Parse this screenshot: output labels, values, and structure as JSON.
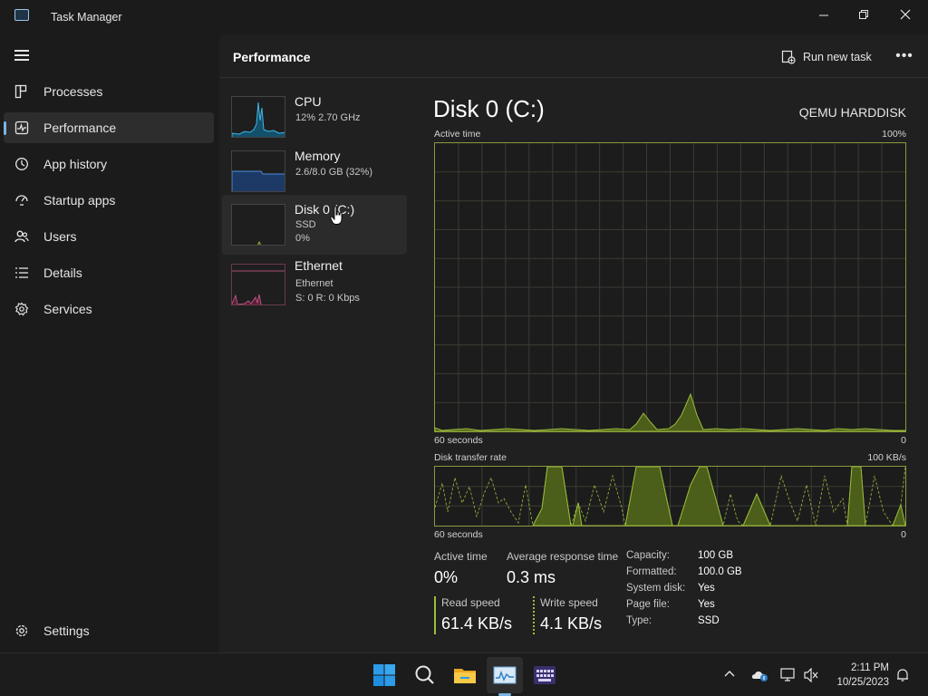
{
  "window": {
    "title": "Task Manager"
  },
  "nav": {
    "items": [
      {
        "label": "Processes",
        "icon": "processes-icon"
      },
      {
        "label": "Performance",
        "icon": "performance-icon",
        "selected": true
      },
      {
        "label": "App history",
        "icon": "app-history-icon"
      },
      {
        "label": "Startup apps",
        "icon": "startup-apps-icon"
      },
      {
        "label": "Users",
        "icon": "users-icon"
      },
      {
        "label": "Details",
        "icon": "details-icon"
      },
      {
        "label": "Services",
        "icon": "services-icon"
      }
    ],
    "settings": {
      "label": "Settings",
      "icon": "gear-icon"
    }
  },
  "header": {
    "title": "Performance",
    "run_new_task": "Run new task"
  },
  "resources": [
    {
      "name": "CPU",
      "line1": "12% 2.70 GHz",
      "line2": "",
      "color": "#3fb6e8"
    },
    {
      "name": "Memory",
      "line1": "2.6/8.0 GB (32%)",
      "line2": "",
      "color": "#4a8de0"
    },
    {
      "name": "Disk 0 (C:)",
      "line1": "SSD",
      "line2": "0%",
      "color": "#9bbd3a",
      "selected": true
    },
    {
      "name": "Ethernet",
      "line1": "Ethernet",
      "line2": "S: 0 R: 0 Kbps",
      "color": "#d35d8f"
    }
  ],
  "detail": {
    "title": "Disk 0 (C:)",
    "model": "QEMU HARDDISK",
    "active_graph": {
      "label": "Active time",
      "max": "100%",
      "time": "60 seconds",
      "min": "0"
    },
    "transfer_graph": {
      "label": "Disk transfer rate",
      "max": "100 KB/s",
      "time": "60 seconds",
      "min": "0"
    },
    "stats": {
      "active_time": {
        "label": "Active time",
        "value": "0%"
      },
      "avg_response": {
        "label": "Average response time",
        "value": "0.3 ms"
      },
      "read_speed": {
        "label": "Read speed",
        "value": "61.4 KB/s"
      },
      "write_speed": {
        "label": "Write speed",
        "value": "4.1 KB/s"
      }
    },
    "properties": [
      {
        "key": "Capacity:",
        "value": "100 GB"
      },
      {
        "key": "Formatted:",
        "value": "100.0 GB"
      },
      {
        "key": "System disk:",
        "value": "Yes"
      },
      {
        "key": "Page file:",
        "value": "Yes"
      },
      {
        "key": "Type:",
        "value": "SSD"
      }
    ]
  },
  "taskbar": {
    "apps": [
      "start-icon",
      "search-icon",
      "file-explorer-icon",
      "task-manager-icon",
      "keyboard-app-icon"
    ],
    "clock": {
      "time": "2:11 PM",
      "date": "10/25/2023"
    }
  },
  "colors": {
    "accent": "#7ab4e6",
    "disk_line": "#9bbd3a",
    "disk_fill": "#5a6e1a"
  }
}
